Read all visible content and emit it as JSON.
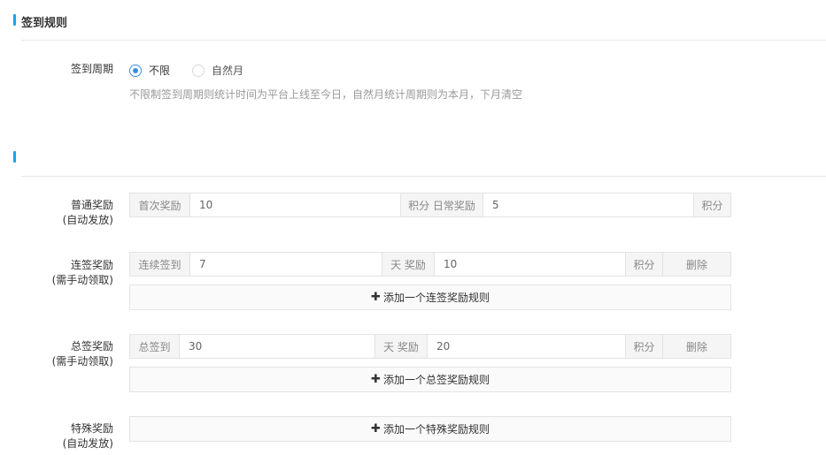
{
  "section1": {
    "title": "签到规则"
  },
  "cycle": {
    "label": "签到周期",
    "options": [
      {
        "label": "不限",
        "checked": true
      },
      {
        "label": "自然月",
        "checked": false
      }
    ],
    "hint": "不限制签到周期则统计时间为平台上线至今日，自然月统计周期则为本月，下月清空"
  },
  "section2": {
    "title": ""
  },
  "normal": {
    "label_line1": "普通奖励",
    "label_line2": "(自动发放)",
    "first_prefix": "首次奖励",
    "first_value": "10",
    "mid_addon": "积分 日常奖励",
    "daily_value": "5",
    "suffix": "积分"
  },
  "continuous": {
    "label_line1": "连签奖励",
    "label_line2": "(需手动领取)",
    "prefix": "连续签到",
    "days_value": "7",
    "mid_addon": "天 奖励",
    "reward_value": "10",
    "suffix": "积分",
    "delete_label": "删除",
    "add_label": "添加一个连签奖励规则"
  },
  "total": {
    "label_line1": "总签奖励",
    "label_line2": "(需手动领取)",
    "prefix": "总签到",
    "days_value": "30",
    "mid_addon": "天 奖励",
    "reward_value": "20",
    "suffix": "积分",
    "delete_label": "删除",
    "add_label": "添加一个总签奖励规则"
  },
  "special": {
    "label_line1": "特殊奖励",
    "label_line2": "(自动发放)",
    "add_label": "添加一个特殊奖励规则"
  },
  "icons": {
    "plus": "plus-icon"
  },
  "colors": {
    "accent": "#1aa3e8",
    "radio": "#3a8ee6"
  }
}
